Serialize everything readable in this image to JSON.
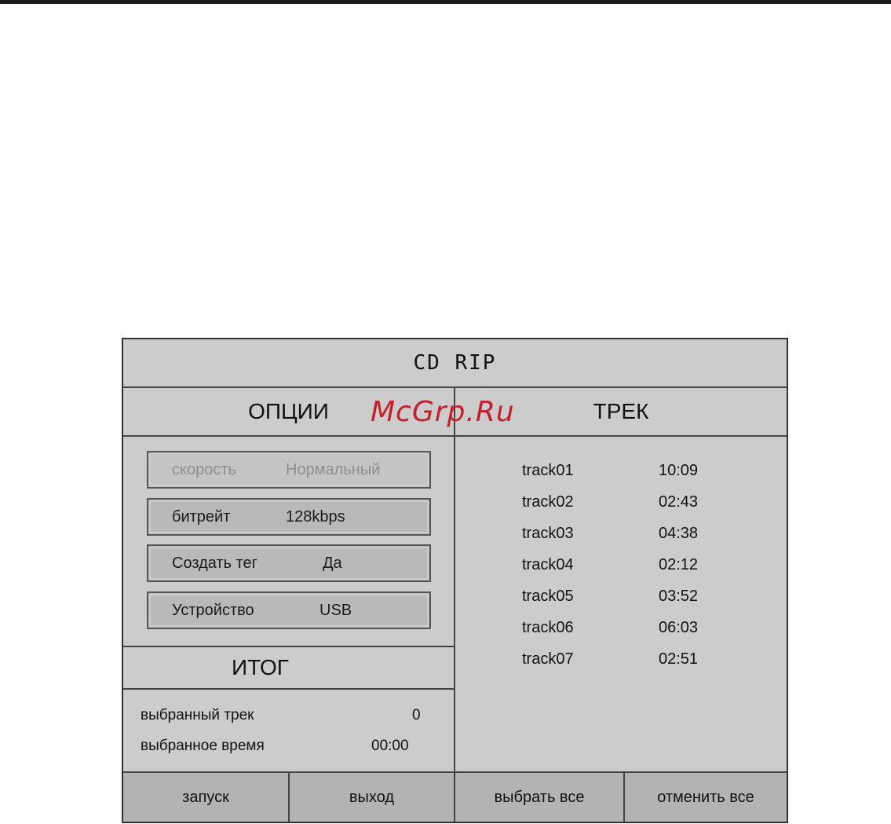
{
  "watermark": "McGrp.Ru",
  "window": {
    "title": "CD RIP"
  },
  "options": {
    "heading": "ОПЦИИ",
    "items": [
      {
        "label": "скорость",
        "value": "Нормальный",
        "enabled": false
      },
      {
        "label": "битрейт",
        "value": "128kbps",
        "enabled": true
      },
      {
        "label": "Создать тег",
        "value": "Да",
        "enabled": true
      },
      {
        "label": "Устройство",
        "value": "USB",
        "enabled": true
      }
    ]
  },
  "summary": {
    "heading": "ИТОГ",
    "selected_track_label": "выбранный трек",
    "selected_track_value": "0",
    "selected_time_label": "выбранное время",
    "selected_time_value": "00:00"
  },
  "tracks": {
    "heading": "ТРЕК",
    "items": [
      {
        "name": "track01",
        "duration": "10:09"
      },
      {
        "name": "track02",
        "duration": "02:43"
      },
      {
        "name": "track03",
        "duration": "04:38"
      },
      {
        "name": "track04",
        "duration": "02:12"
      },
      {
        "name": "track05",
        "duration": "03:52"
      },
      {
        "name": "track06",
        "duration": "06:03"
      },
      {
        "name": "track07",
        "duration": "02:51"
      }
    ]
  },
  "buttons": {
    "start": "запуск",
    "exit": "выход",
    "select_all": "выбрать все",
    "deselect_all": "отменить все"
  },
  "colors": {
    "panel": "#cccccc",
    "button_bar": "#b3b3b3",
    "watermark": "#c81e2a"
  }
}
